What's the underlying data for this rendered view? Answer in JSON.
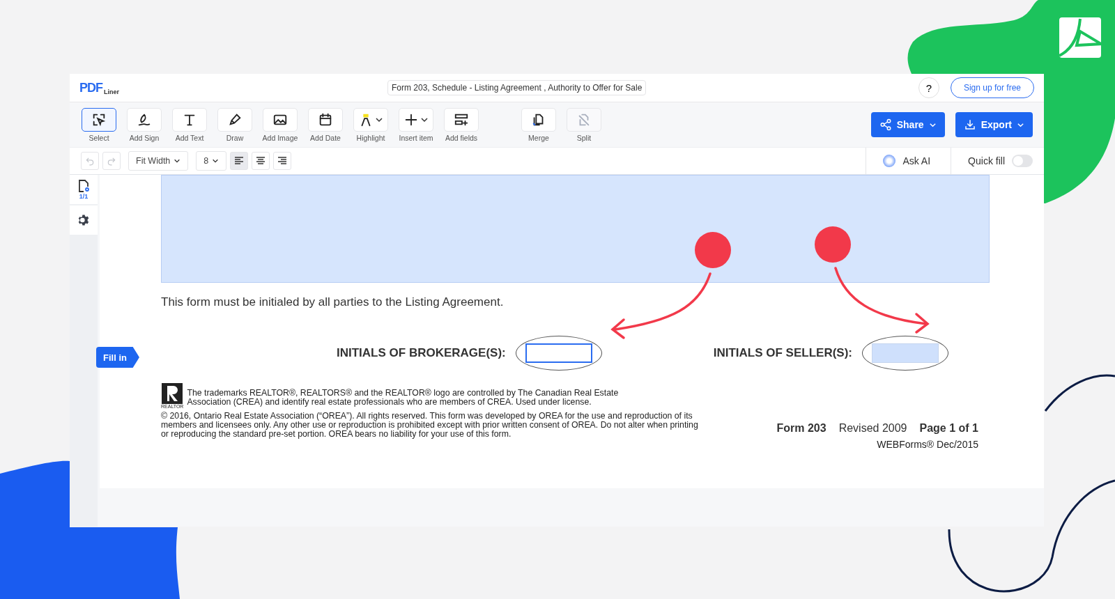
{
  "header": {
    "logo_main": "PDF",
    "logo_sub": "Liner",
    "document_title": "Form 203, Schedule - Listing Agreement , Authority to Offer for Sale",
    "help": "?",
    "signup": "Sign up for free"
  },
  "tools": [
    {
      "label": "Select",
      "kind": "select",
      "dropdown": false,
      "selected": true,
      "disabled": false
    },
    {
      "label": "Add Sign",
      "kind": "sign",
      "dropdown": false,
      "selected": false,
      "disabled": false
    },
    {
      "label": "Add Text",
      "kind": "text",
      "dropdown": false,
      "selected": false,
      "disabled": false
    },
    {
      "label": "Draw",
      "kind": "draw",
      "dropdown": false,
      "selected": false,
      "disabled": false
    },
    {
      "label": "Add Image",
      "kind": "image",
      "dropdown": false,
      "selected": false,
      "disabled": false
    },
    {
      "label": "Add Date",
      "kind": "date",
      "dropdown": false,
      "selected": false,
      "disabled": false
    },
    {
      "label": "Highlight",
      "kind": "highlight",
      "dropdown": true,
      "selected": false,
      "disabled": false
    },
    {
      "label": "Insert item",
      "kind": "insert",
      "dropdown": true,
      "selected": false,
      "disabled": false
    },
    {
      "label": "Add fields",
      "kind": "fields",
      "dropdown": false,
      "selected": false,
      "disabled": false
    },
    {
      "label": "Merge",
      "kind": "merge",
      "dropdown": false,
      "selected": false,
      "disabled": false
    },
    {
      "label": "Split",
      "kind": "split",
      "dropdown": false,
      "selected": false,
      "disabled": true
    }
  ],
  "actions": [
    {
      "label": "Share",
      "kind": "share"
    },
    {
      "label": "Export",
      "kind": "export"
    }
  ],
  "format_bar": {
    "undo_disabled": true,
    "redo_disabled": true,
    "zoom": "Fit Width",
    "font_size": "8",
    "align": [
      {
        "kind": "left",
        "selected": true
      },
      {
        "kind": "center",
        "selected": false
      },
      {
        "kind": "right",
        "selected": false
      }
    ],
    "ask_ai": "Ask AI",
    "quick_fill": {
      "label": "Quick fill",
      "on": false
    }
  },
  "sidebar": {
    "page_count": "1/1"
  },
  "fill_in": "Fill in",
  "document": {
    "notice": "This form must be initialed by all parties to the Listing Agreement.",
    "initials": [
      {
        "label": "INITIALS OF BROKERAGE(S):",
        "focused": true,
        "filled": false
      },
      {
        "label": "INITIALS OF SELLER(S):",
        "focused": false,
        "filled": true
      }
    ],
    "logo_caption": "REALTOR",
    "trademark": "The trademarks REALTOR®, REALTORS® and the REALTOR® logo are controlled by The Canadian Real Estate Association (CREA) and identify real estate professionals who are members of CREA. Used under license.",
    "copyright": "© 2016, Ontario Real Estate Association (“OREA”). All rights reserved. This form was developed by OREA for the use and reproduction of its members and licensees only. Any other use or reproduction is prohibited except with prior written consent of OREA. Do not alter when printing or reproducing the standard pre-set portion. OREA bears no liability for your use of this form.",
    "form": "Form 203",
    "revised": "Revised 2009",
    "page": "Page **1** of **1**",
    "webforms": "WEBForms® Dec/2015"
  }
}
